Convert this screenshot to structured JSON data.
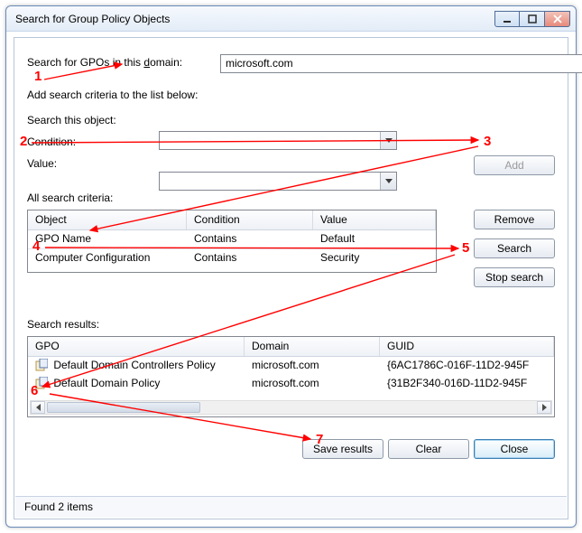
{
  "window": {
    "title": "Search for Group Policy Objects"
  },
  "domain": {
    "label_pre": "Search for GPOs in this ",
    "label_u": "d",
    "label_post": "omain:",
    "value": "microsoft.com"
  },
  "criteria_hint": "Add search criteria to the list below:",
  "search_object": {
    "label": "Search this object:",
    "value": ""
  },
  "condition": {
    "label": "Condition:",
    "value": ""
  },
  "value_row": {
    "label": "Value:",
    "value": ""
  },
  "buttons": {
    "add": "Add",
    "remove": "Remove",
    "search": "Search",
    "stop": "Stop search",
    "save": "Save results",
    "clear": "Clear",
    "close": "Close"
  },
  "criteria_table": {
    "title": "All search criteria:",
    "headers": [
      "Object",
      "Condition",
      "Value"
    ],
    "rows": [
      [
        "GPO Name",
        "Contains",
        "Default"
      ],
      [
        "Computer Configuration",
        "Contains",
        "Security"
      ]
    ]
  },
  "results": {
    "title": "Search results:",
    "headers": [
      "GPO",
      "Domain",
      "GUID"
    ],
    "rows": [
      [
        "Default Domain Controllers Policy",
        "microsoft.com",
        "{6AC1786C-016F-11D2-945F"
      ],
      [
        "Default Domain Policy",
        "microsoft.com",
        "{31B2F340-016D-11D2-945F"
      ]
    ]
  },
  "status": "Found 2 items",
  "annotations": {
    "1": "1",
    "2": "2",
    "3": "3",
    "4": "4",
    "5": "5",
    "6": "6",
    "7": "7"
  }
}
